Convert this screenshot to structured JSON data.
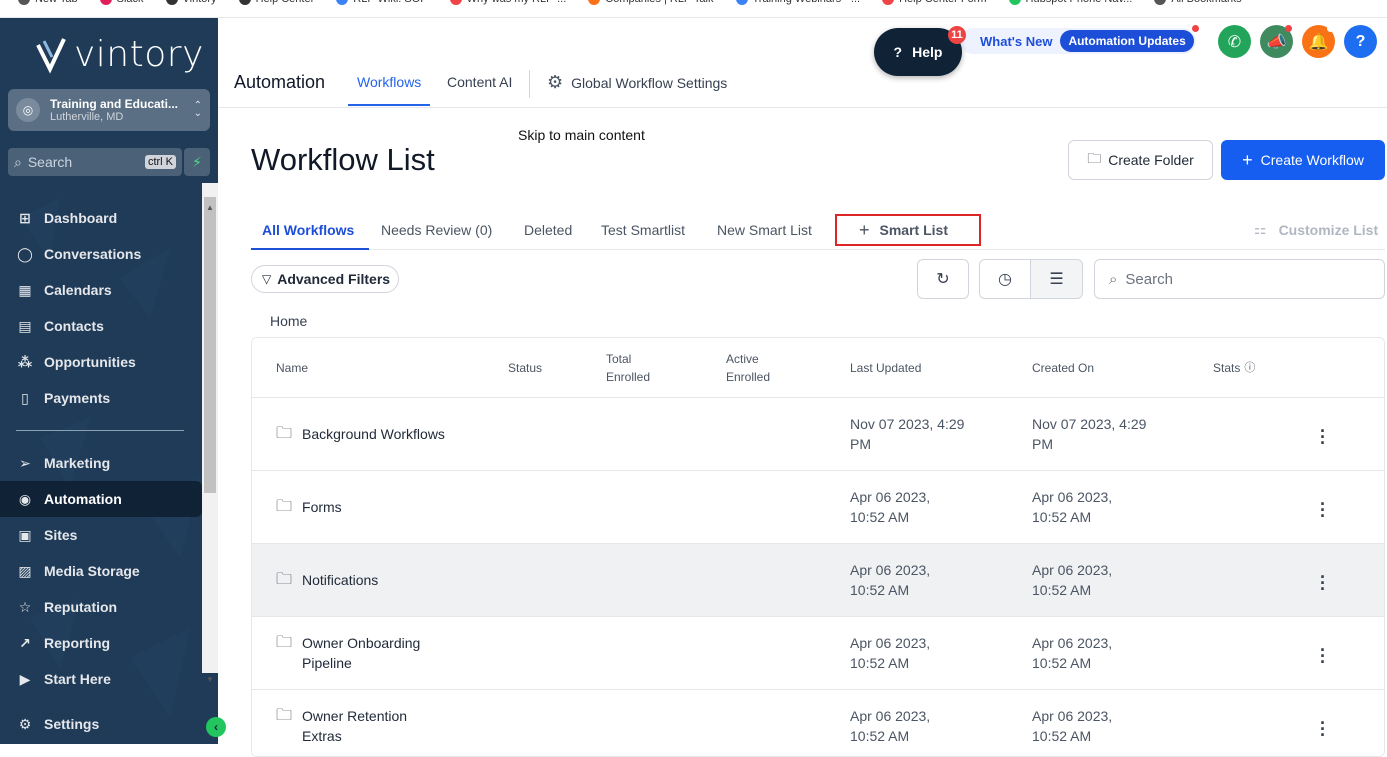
{
  "bookmarks": [
    {
      "label": "New Tab",
      "color": "#555"
    },
    {
      "label": "Slack",
      "color": "#e01e5a"
    },
    {
      "label": "Vintory",
      "color": "#333"
    },
    {
      "label": "Help Center",
      "color": "#333"
    },
    {
      "label": "RLP Wiki: SOP",
      "color": "#3b82f6"
    },
    {
      "label": "Why was my RLP-...",
      "color": "#ef4444"
    },
    {
      "label": "Companies | RLP Talk",
      "color": "#f97316"
    },
    {
      "label": "Training Webinars - ...",
      "color": "#3b82f6"
    },
    {
      "label": "Help Center Form",
      "color": "#ef4444"
    },
    {
      "label": "Hubspot Phone Nav...",
      "color": "#22c55e"
    },
    {
      "label": "All Bookmarks",
      "color": "#555"
    }
  ],
  "sidebar": {
    "logo": "vintory",
    "account_name": "Training and Educati...",
    "account_location": "Lutherville, MD",
    "search_placeholder": "Search",
    "search_shortcut": "ctrl K",
    "items_top": [
      {
        "label": "Dashboard",
        "icon": "grid-icon",
        "glyph": "⊞"
      },
      {
        "label": "Conversations",
        "icon": "chat-icon",
        "glyph": "◯"
      },
      {
        "label": "Calendars",
        "icon": "calendar-icon",
        "glyph": "▦"
      },
      {
        "label": "Contacts",
        "icon": "contacts-icon",
        "glyph": "▤"
      },
      {
        "label": "Opportunities",
        "icon": "opportunities-icon",
        "glyph": "⁂"
      },
      {
        "label": "Payments",
        "icon": "payments-icon",
        "glyph": "▯"
      }
    ],
    "items_bottom": [
      {
        "label": "Marketing",
        "icon": "send-icon",
        "glyph": "➢"
      },
      {
        "label": "Automation",
        "icon": "automation-icon",
        "glyph": "◉",
        "active": true
      },
      {
        "label": "Sites",
        "icon": "sites-icon",
        "glyph": "▣"
      },
      {
        "label": "Media Storage",
        "icon": "media-icon",
        "glyph": "▨"
      },
      {
        "label": "Reputation",
        "icon": "star-icon",
        "glyph": "☆"
      },
      {
        "label": "Reporting",
        "icon": "chart-icon",
        "glyph": "↗"
      },
      {
        "label": "Start Here",
        "icon": "play-icon",
        "glyph": "▶"
      }
    ],
    "settings_label": "Settings"
  },
  "header": {
    "title": "Automation",
    "tabs": [
      "Workflows",
      "Content AI"
    ],
    "global_settings": "Global Workflow Settings",
    "help_label": "Help",
    "help_badge": "11",
    "whats_new": "What's New",
    "automation_updates": "Automation Updates"
  },
  "skip_link": "Skip to main content",
  "page": {
    "title": "Workflow List",
    "create_folder": "Create Folder",
    "create_workflow": "Create Workflow"
  },
  "subtabs": {
    "items": [
      "All Workflows",
      "Needs Review (0)",
      "Deleted",
      "Test Smartlist",
      "New Smart List"
    ],
    "add_smart_list": "Smart List",
    "customize": "Customize List"
  },
  "filters": {
    "advanced": "Advanced Filters",
    "search_placeholder": "Search"
  },
  "breadcrumb": "Home",
  "table": {
    "headers": {
      "name": "Name",
      "status": "Status",
      "total_1": "Total",
      "total_2": "Enrolled",
      "active_1": "Active",
      "active_2": "Enrolled",
      "last_updated": "Last Updated",
      "created_on": "Created On",
      "stats": "Stats"
    },
    "rows": [
      {
        "name_1": "Background Workflows",
        "name_2": "",
        "updated_1": "Nov 07 2023, 4:29",
        "updated_2": "PM",
        "created_1": "Nov 07 2023, 4:29",
        "created_2": "PM"
      },
      {
        "name_1": "Forms",
        "name_2": "",
        "updated_1": "Apr 06 2023,",
        "updated_2": "10:52 AM",
        "created_1": "Apr 06 2023,",
        "created_2": "10:52 AM"
      },
      {
        "name_1": "Notifications",
        "name_2": "",
        "updated_1": "Apr 06 2023,",
        "updated_2": "10:52 AM",
        "created_1": "Apr 06 2023,",
        "created_2": "10:52 AM"
      },
      {
        "name_1": "Owner Onboarding",
        "name_2": "Pipeline",
        "updated_1": "Apr 06 2023,",
        "updated_2": "10:52 AM",
        "created_1": "Apr 06 2023,",
        "created_2": "10:52 AM"
      },
      {
        "name_1": "Owner Retention",
        "name_2": "Extras",
        "updated_1": "Apr 06 2023,",
        "updated_2": "10:52 AM",
        "created_1": "Apr 06 2023,",
        "created_2": "10:52 AM"
      }
    ]
  }
}
